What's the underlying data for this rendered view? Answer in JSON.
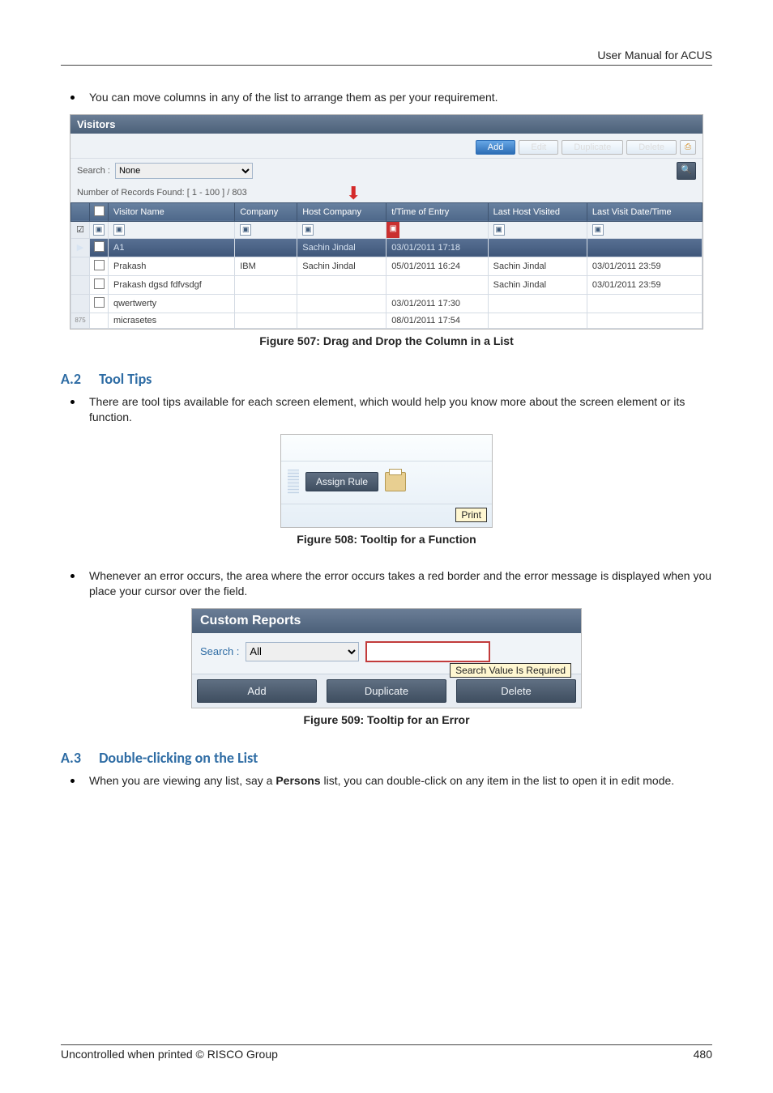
{
  "header": {
    "title": "User Manual for ACUS"
  },
  "bullets": {
    "b1": "You can move columns in any of the list to arrange them as per your requirement.",
    "b2": "There are tool tips available for each screen element, which would help you know more about the screen element or its function.",
    "b3": "Whenever an error occurs, the area where the error occurs takes a red border and the error message is displayed when you place your cursor over the field.",
    "b4_pre": "When you are viewing any list, say a ",
    "b4_bold": "Persons",
    "b4_post": " list, you can double-click on any item in the list to open it in edit mode."
  },
  "sections": {
    "a2_num": "A.2",
    "a2_title": "Tool Tips",
    "a3_num": "A.3",
    "a3_title": "Double-clicking on the List"
  },
  "captions": {
    "f507": "Figure 507: Drag and Drop the Column in a List",
    "f508": "Figure 508: Tooltip for a Function",
    "f509": "Figure 509: Tooltip for an Error"
  },
  "visitors": {
    "title": "Visitors",
    "toolbar": {
      "add": "Add",
      "edit": "Edit",
      "duplicate": "Duplicate",
      "delete": "Delete"
    },
    "search_label": "Search :",
    "search_value": "None",
    "count": "Number of Records Found: [ 1 - 100 ] / 803",
    "columns": {
      "visitor": "Visitor Name",
      "company": "Company",
      "host": "Host Company",
      "time": "t/Time of Entry",
      "lasthost": "Last Host Visited",
      "lastvisit": "Last Visit Date/Time"
    },
    "drag_cell_host": "Sachin Jindal",
    "drag_cell_time": "03/01/2011 17:18",
    "rows": [
      {
        "visitor": "Prakash",
        "company": "IBM",
        "host": "Sachin Jindal",
        "time": "05/01/2011 16:24",
        "lasthost": "Sachin Jindal",
        "lastvisit": "03/01/2011 23:59"
      },
      {
        "visitor": "Prakash dgsd fdfvsdgf",
        "company": "",
        "host": "",
        "time": "",
        "lasthost": "Sachin Jindal",
        "lastvisit": "03/01/2011 23:59"
      },
      {
        "visitor": "qwertwerty",
        "company": "",
        "host": "",
        "time": "03/01/2011 17:30",
        "lasthost": "",
        "lastvisit": ""
      },
      {
        "visitor": "micrasetes",
        "company": "",
        "host": "",
        "time": "08/01/2011 17:54",
        "lasthost": "",
        "lastvisit": ""
      }
    ]
  },
  "tooltip_fig": {
    "button": "Assign Rule",
    "tooltip": "Print"
  },
  "error_fig": {
    "title": "Custom Reports",
    "search_label": "Search :",
    "search_value": "All",
    "error_tip": "Search Value Is Required",
    "buttons": {
      "add": "Add",
      "duplicate": "Duplicate",
      "delete": "Delete"
    }
  },
  "footer": {
    "left": "Uncontrolled when printed © RISCO Group",
    "right": "480"
  }
}
